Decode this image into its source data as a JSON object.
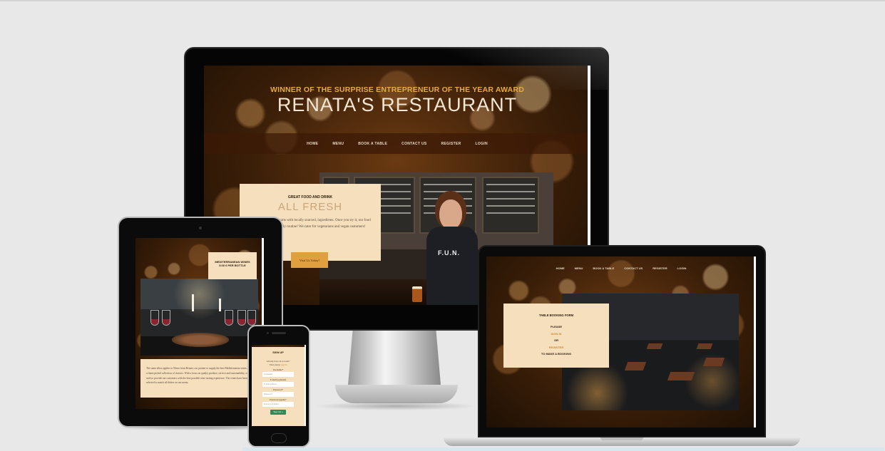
{
  "desktop": {
    "award": "WINNER OF THE SURPRISE ENTREPRENEUR OF THE YEAR AWARD",
    "title": "RENATA'S RESTAURANT",
    "nav": [
      "HOME",
      "MENU",
      "BOOK A TABLE",
      "CONTACT US",
      "REGISTER",
      "LOGIN"
    ],
    "promo": {
      "kicker": "GREAT FOOD AND DRINK",
      "heading": "ALL FRESH",
      "body": "quality artisan food starts with locally sourced, ingredients. Once you try it, our food will be a your weekly routine! We cater for vegetarians and vegan customers!",
      "button": "Visit Us Today!"
    },
    "shirt_text": "F.U.N."
  },
  "tablet": {
    "card": [
      "MEDITERRANEAN WINES",
      "5.00 € PER BOTTLE"
    ],
    "text": "The same ethos applies to Wines from Renata, our partner to supply the best Mediterranean wines and a finest picked collection of classics. With a focus on quality produce, service and sustainability, we seek to provide our customers with the best possible wine tasting experience. The wines have been selected to match all dishes on our menu."
  },
  "phone": {
    "title": "SIGN UP",
    "question": "Already have an account?",
    "prompt": "Then please",
    "prompt_link": "sign in",
    "username_label": "Username*",
    "username_placeholder": "Username",
    "email_label": "E-mail (optional)",
    "email_placeholder": "E-mail address",
    "password_label": "Password*",
    "password_placeholder": "Password",
    "password_again_label": "Password (again)*",
    "password_again_placeholder": "Password (again)",
    "submit": "Sign Up »"
  },
  "laptop": {
    "nav": [
      "HOME",
      "MENU",
      "BOOK A TABLE",
      "CONTACT US",
      "REGISTER",
      "LOGIN"
    ],
    "booking": {
      "title": "TABLE BOOKING FORM",
      "please": "PLEASE",
      "sign_in": "SIGN IN",
      "or": "OR",
      "register": "REGISTER",
      "tail": "TO MAKE A BOOKING"
    }
  },
  "colors": {
    "accent": "#e8a940",
    "card": "#f5dfbd",
    "link": "#d08a30",
    "button": "#e0a040",
    "signup_button": "#2e8a57"
  }
}
